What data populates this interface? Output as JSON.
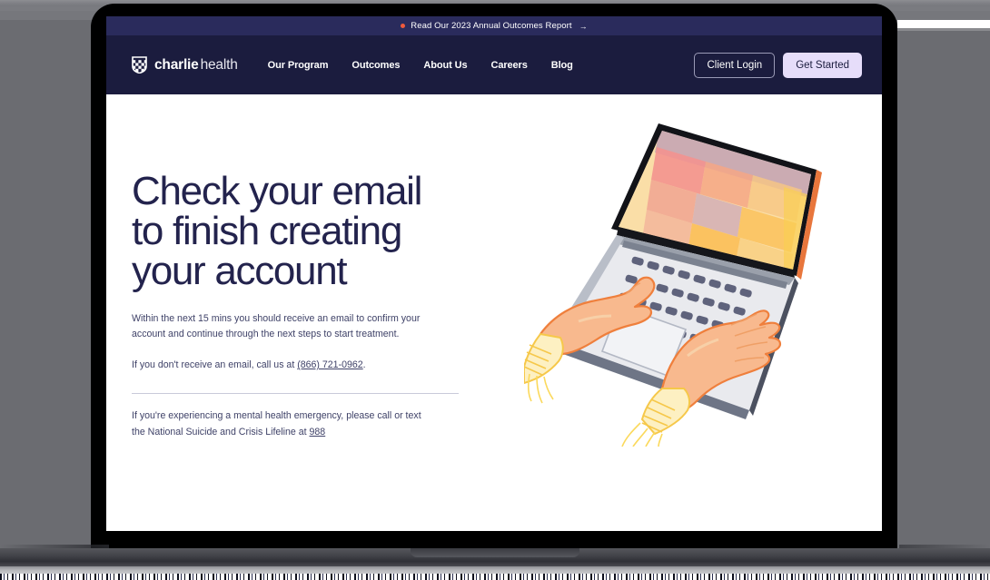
{
  "announcement": {
    "text": "Read Our 2023 Annual Outcomes Report",
    "arrow": "→",
    "dot_icon": "orange-dot-icon",
    "dot_color": "#f05a3c"
  },
  "navbar": {
    "brand": {
      "icon": "charlie-health-shield-icon",
      "name_bold": "charlie",
      "name_light": "health"
    },
    "links": [
      {
        "label": "Our Program"
      },
      {
        "label": "Outcomes"
      },
      {
        "label": "About Us"
      },
      {
        "label": "Careers"
      },
      {
        "label": "Blog"
      }
    ],
    "actions": {
      "login_label": "Client Login",
      "get_started_label": "Get Started"
    },
    "bg_color": "#1b1c3e",
    "banner_bg_color": "#2a2b5c",
    "accent_color": "#e6ddfa"
  },
  "main": {
    "headline": "Check your email to finish creating your account",
    "paragraph_one": "Within the next 15 mins you should receive an email to confirm your account and continue through the next steps to start treatment.",
    "paragraph_two_prefix": "If you don't receive an email, call us at ",
    "phone_number": "(866) 721-0962",
    "paragraph_two_suffix": ".",
    "crisis_prefix": "If you're experiencing a mental health emergency, please call or text the National Suicide and Crisis Lifeline at ",
    "crisis_number": "988",
    "heading_color": "#23234d",
    "body_color": "#3f4268"
  },
  "illustration": {
    "name": "hands-typing-on-laptop-watercolor-illustration",
    "alt": "Illustration of two hands typing on a laptop with a colorful watercolor screen"
  },
  "device_frame": {
    "name": "laptop-device-mockup",
    "bezel_color": "#000000",
    "backdrop_color": "#6b6c71"
  }
}
